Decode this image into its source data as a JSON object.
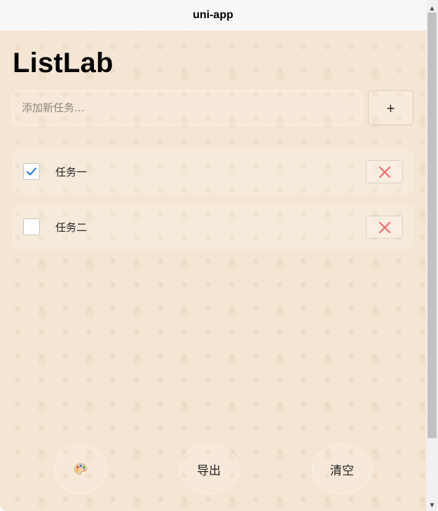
{
  "navbar": {
    "title": "uni-app"
  },
  "app": {
    "title": "ListLab"
  },
  "input": {
    "placeholder": "添加新任务..."
  },
  "add_button": {
    "label": "+"
  },
  "tasks": [
    {
      "label": "任务一",
      "checked": true
    },
    {
      "label": "任务二",
      "checked": false
    }
  ],
  "icons": {
    "check": "check-icon",
    "delete": "close-icon",
    "theme": "palette-icon"
  },
  "colors": {
    "background": "#f5e6d3",
    "check": "#1a73e8",
    "delete": "#f26b6b"
  },
  "bottom_bar": {
    "export_label": "导出",
    "clear_label": "清空"
  }
}
